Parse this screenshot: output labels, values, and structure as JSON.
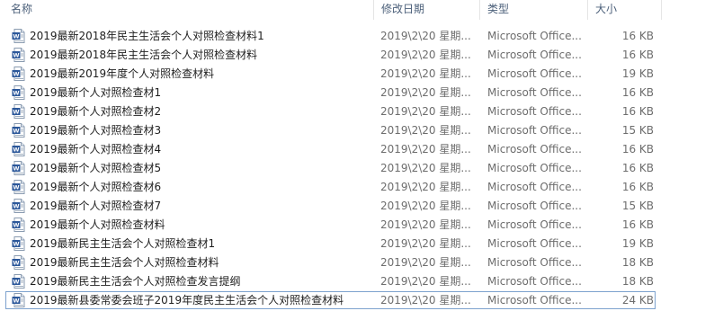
{
  "columns": {
    "name": "名称",
    "date": "修改日期",
    "type": "类型",
    "size": "大小"
  },
  "files": [
    {
      "name": "2019最新2018年民主生活会个人对照检查材料1",
      "date": "2019\\2\\20 星期...",
      "type": "Microsoft Office...",
      "size": "16 KB",
      "icon": "word-doc-icon"
    },
    {
      "name": "2019最新2018年民主生活会个人对照检查材料",
      "date": "2019\\2\\20 星期...",
      "type": "Microsoft Office...",
      "size": "16 KB",
      "icon": "word-doc-icon"
    },
    {
      "name": "2019最新2019年度个人对照检查材料",
      "date": "2019\\2\\20 星期...",
      "type": "Microsoft Office...",
      "size": "19 KB",
      "icon": "word-doc-icon"
    },
    {
      "name": "2019最新个人对照检查材1",
      "date": "2019\\2\\20 星期...",
      "type": "Microsoft Office...",
      "size": "16 KB",
      "icon": "word-doc-icon"
    },
    {
      "name": "2019最新个人对照检查材2",
      "date": "2019\\2\\20 星期...",
      "type": "Microsoft Office...",
      "size": "16 KB",
      "icon": "word-doc-icon"
    },
    {
      "name": "2019最新个人对照检查材3",
      "date": "2019\\2\\20 星期...",
      "type": "Microsoft Office...",
      "size": "15 KB",
      "icon": "word-doc-icon"
    },
    {
      "name": "2019最新个人对照检查材4",
      "date": "2019\\2\\20 星期...",
      "type": "Microsoft Office...",
      "size": "16 KB",
      "icon": "word-doc-icon"
    },
    {
      "name": "2019最新个人对照检查材5",
      "date": "2019\\2\\20 星期...",
      "type": "Microsoft Office...",
      "size": "16 KB",
      "icon": "word-doc-icon"
    },
    {
      "name": "2019最新个人对照检查材6",
      "date": "2019\\2\\20 星期...",
      "type": "Microsoft Office...",
      "size": "16 KB",
      "icon": "word-doc-icon"
    },
    {
      "name": "2019最新个人对照检查材7",
      "date": "2019\\2\\20 星期...",
      "type": "Microsoft Office...",
      "size": "15 KB",
      "icon": "word-doc-icon"
    },
    {
      "name": "2019最新个人对照检查材料",
      "date": "2019\\2\\20 星期...",
      "type": "Microsoft Office...",
      "size": "16 KB",
      "icon": "word-doc-icon"
    },
    {
      "name": "2019最新民主生活会个人对照检查材1",
      "date": "2019\\2\\20 星期...",
      "type": "Microsoft Office...",
      "size": "19 KB",
      "icon": "word-doc-icon"
    },
    {
      "name": "2019最新民主生活会个人对照检查材料",
      "date": "2019\\2\\20 星期...",
      "type": "Microsoft Office...",
      "size": "18 KB",
      "icon": "word-doc-icon"
    },
    {
      "name": "2019最新民主生活会个人对照检查发言提纲",
      "date": "2019\\2\\20 星期...",
      "type": "Microsoft Office...",
      "size": "18 KB",
      "icon": "word-doc-icon"
    },
    {
      "name": "2019最新县委常委会班子2019年度民主生活会个人对照检查材料",
      "date": "2019\\2\\20 星期...",
      "type": "Microsoft Office...",
      "size": "24 KB",
      "icon": "word-doc-icon",
      "focused": true
    }
  ],
  "colors": {
    "header_text": "#4c607a",
    "focus_border": "#7da2ce",
    "doc_blue": "#2b579a"
  }
}
